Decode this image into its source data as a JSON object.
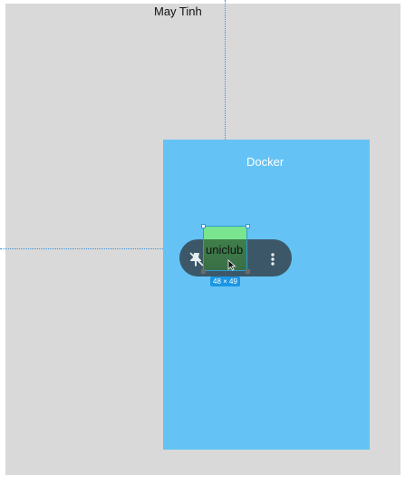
{
  "canvas": {
    "frame_title": "May Tinh",
    "container_label": "Docker",
    "component_label": "uniclub",
    "size_badge": "48 × 49"
  },
  "toolbar": {
    "buttons": [
      {
        "icon": "unpin-icon"
      },
      {
        "icon": "detach-link-icon"
      },
      {
        "icon": "more-vertical-icon"
      }
    ]
  },
  "colors": {
    "canvas_bg": "#d9d9d9",
    "docker_bg": "#64c3f4",
    "toolbar_bg": "#3c5868",
    "selection": "#2a9bd8",
    "component_top": "#7ae58f"
  }
}
